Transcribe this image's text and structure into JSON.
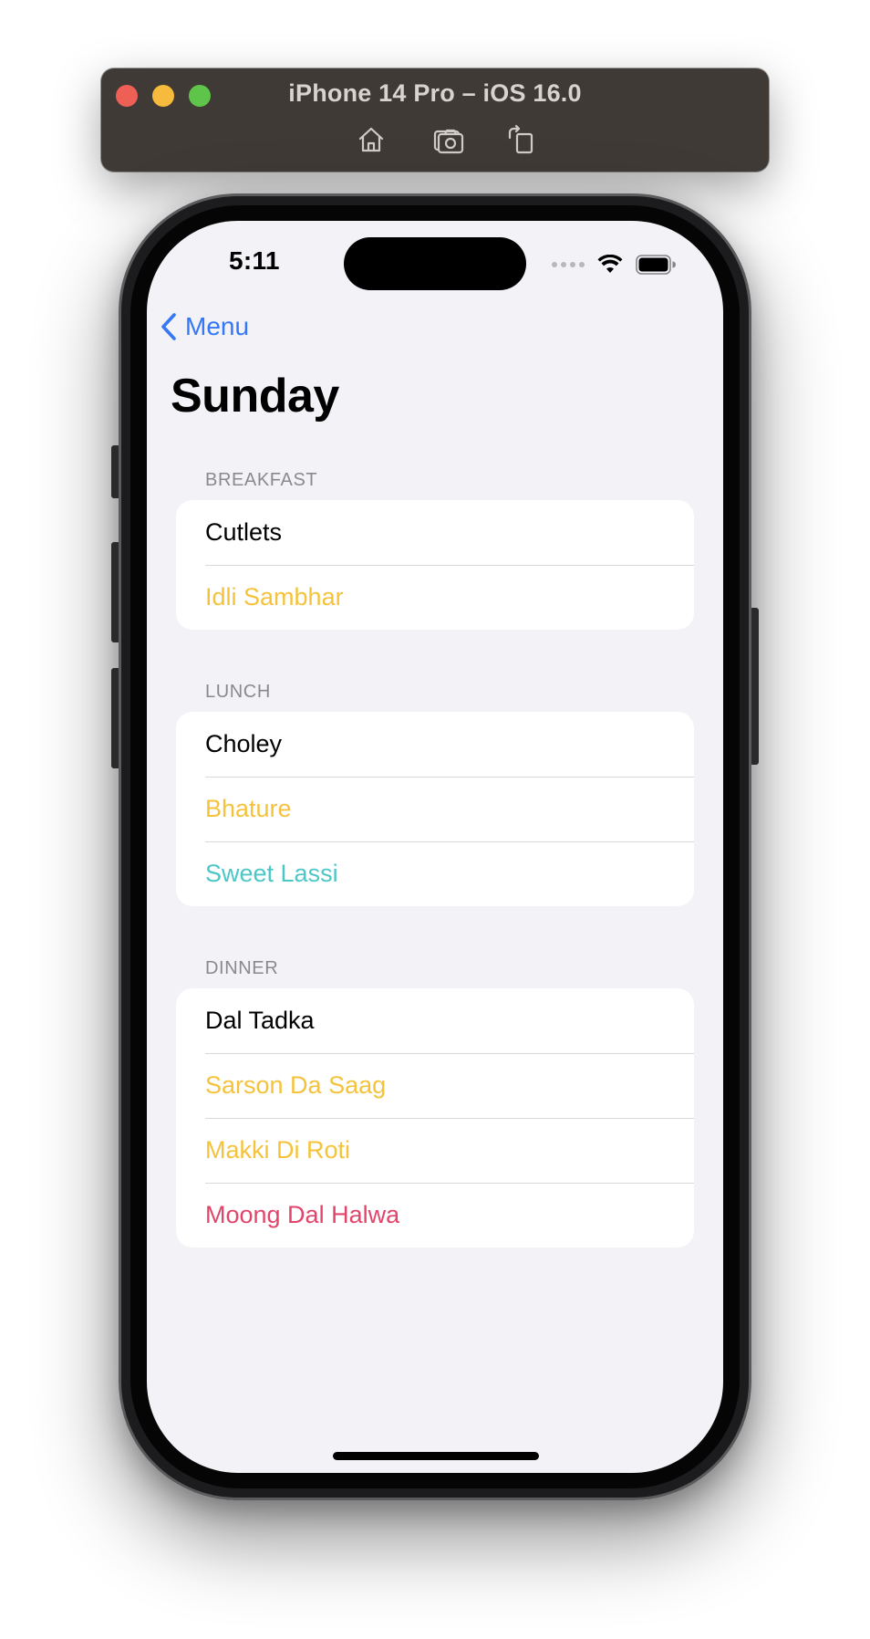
{
  "simulator": {
    "title": "iPhone 14 Pro – iOS 16.0",
    "tools": {
      "home_icon": "home-icon",
      "screenshot_icon": "camera-icon",
      "rotate_icon": "rotate-icon"
    }
  },
  "status_bar": {
    "time": "5:11"
  },
  "nav": {
    "back_label": "Menu",
    "title": "Sunday"
  },
  "sections": [
    {
      "header": "BREAKFAST",
      "items": [
        {
          "label": "Cutlets",
          "color": "#000000"
        },
        {
          "label": "Idli Sambhar",
          "color": "#f5c33b"
        }
      ]
    },
    {
      "header": "LUNCH",
      "items": [
        {
          "label": "Choley",
          "color": "#000000"
        },
        {
          "label": "Bhature",
          "color": "#f5c33b"
        },
        {
          "label": "Sweet Lassi",
          "color": "#4cc7c7"
        }
      ]
    },
    {
      "header": "DINNER",
      "items": [
        {
          "label": "Dal Tadka",
          "color": "#000000"
        },
        {
          "label": "Sarson Da Saag",
          "color": "#f5c33b"
        },
        {
          "label": "Makki Di Roti",
          "color": "#f5c33b"
        },
        {
          "label": "Moong Dal Halwa",
          "color": "#e2456a"
        }
      ]
    }
  ],
  "colors": {
    "accent": "#3478f6",
    "background": "#f2f2f7",
    "titlebar": "#403a37"
  }
}
